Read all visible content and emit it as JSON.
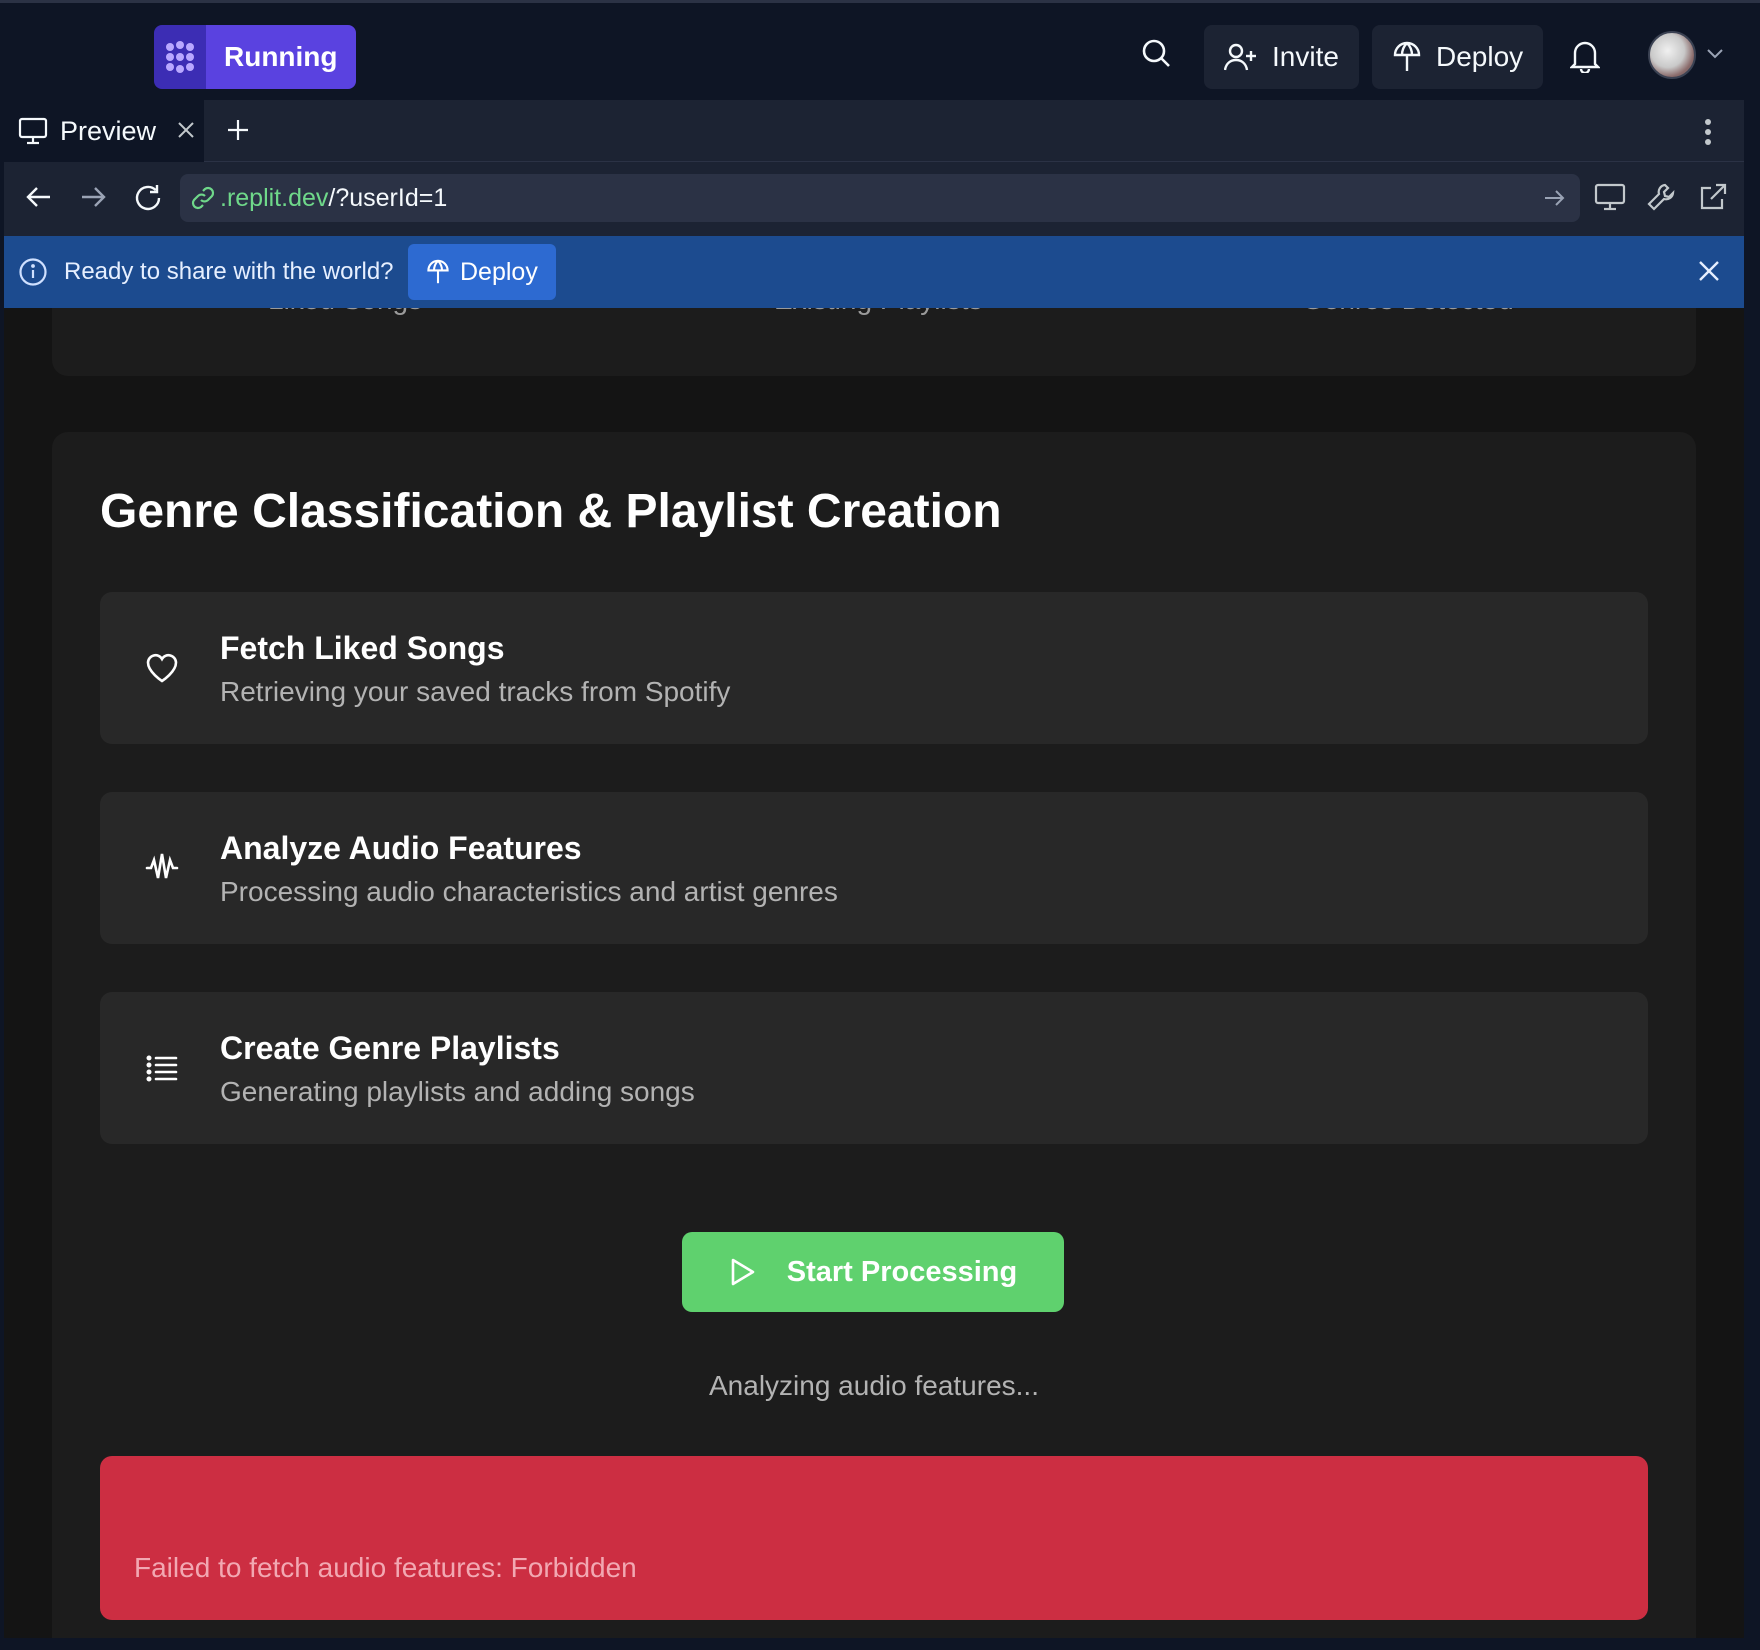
{
  "topbar": {
    "run_label": "Running",
    "invite_label": "Invite",
    "deploy_label": "Deploy"
  },
  "tabs": {
    "preview_label": "Preview"
  },
  "address": {
    "domain": ".replit.dev",
    "path": "/?userId=1"
  },
  "banner": {
    "message": "Ready to share with the world?",
    "deploy_label": "Deploy"
  },
  "stats": {
    "labels": [
      "Liked Songs",
      "Existing Playlists",
      "Genres Detected"
    ]
  },
  "main": {
    "title": "Genre Classification & Playlist Creation",
    "steps": [
      {
        "title": "Fetch Liked Songs",
        "desc": "Retrieving your saved tracks from Spotify",
        "icon": "heart-icon"
      },
      {
        "title": "Analyze Audio Features",
        "desc": "Processing audio characteristics and artist genres",
        "icon": "waveform-icon"
      },
      {
        "title": "Create Genre Playlists",
        "desc": "Generating playlists and adding songs",
        "icon": "list-icon"
      }
    ],
    "start_label": "Start Processing",
    "status": "Analyzing audio features...",
    "error": "Failed to fetch audio features: Forbidden"
  },
  "colors": {
    "accent_green": "#5fd16e",
    "error_red": "#cc2e42",
    "banner_blue": "#1c4b8f",
    "run_purple": "#5a42e0"
  }
}
